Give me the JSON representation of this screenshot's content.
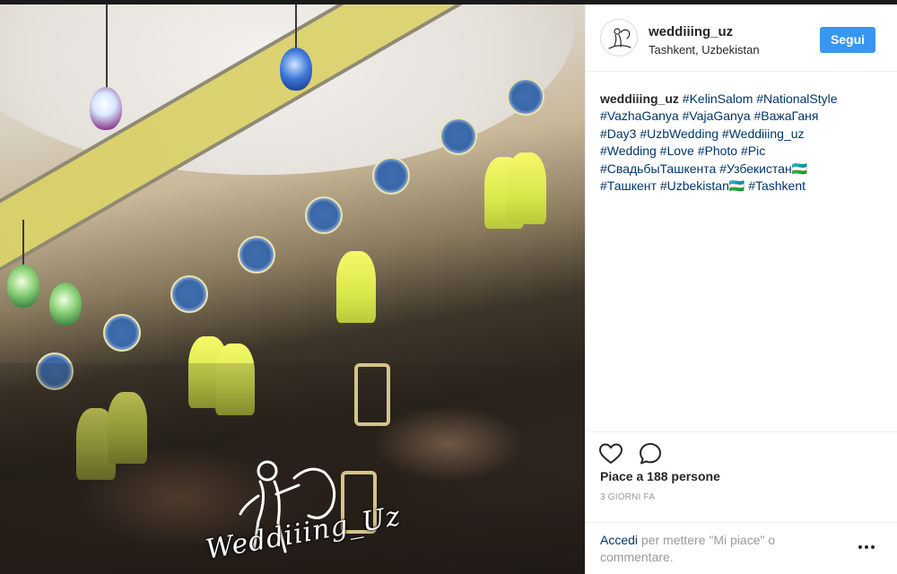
{
  "post": {
    "username": "weddiiing_uz",
    "location": "Tashkent, Uzbekistan",
    "follow_label": "Segui",
    "caption_user": "weddiiing_uz",
    "caption_lines": [
      "#KelinSalom #NationalStyle",
      "#VazhaGanya #VajaGanya #ВажаГаня",
      "#Day3 #UzbWedding #Weddiiing_uz",
      "#Wedding #Love #Photo #Pic",
      "#СвадьбыТашкента #Узбекистан🇺🇿",
      "#Ташкент #Uzbekistan🇺🇿 #Tashkent"
    ],
    "likes": "Piace a 188 persone",
    "timestamp": "3 GIORNI FA",
    "login_link": "Accedi",
    "login_rest": " per mettere \"Mi piace\" o commentare."
  },
  "photo": {
    "watermark": "Weddiiing_Uz"
  },
  "icons": {
    "like": "heart-icon",
    "comment": "comment-icon",
    "more": "more-options-icon"
  },
  "colors": {
    "follow_button": "#3897f0",
    "link": "#003569",
    "muted": "#999999",
    "text": "#262626"
  }
}
